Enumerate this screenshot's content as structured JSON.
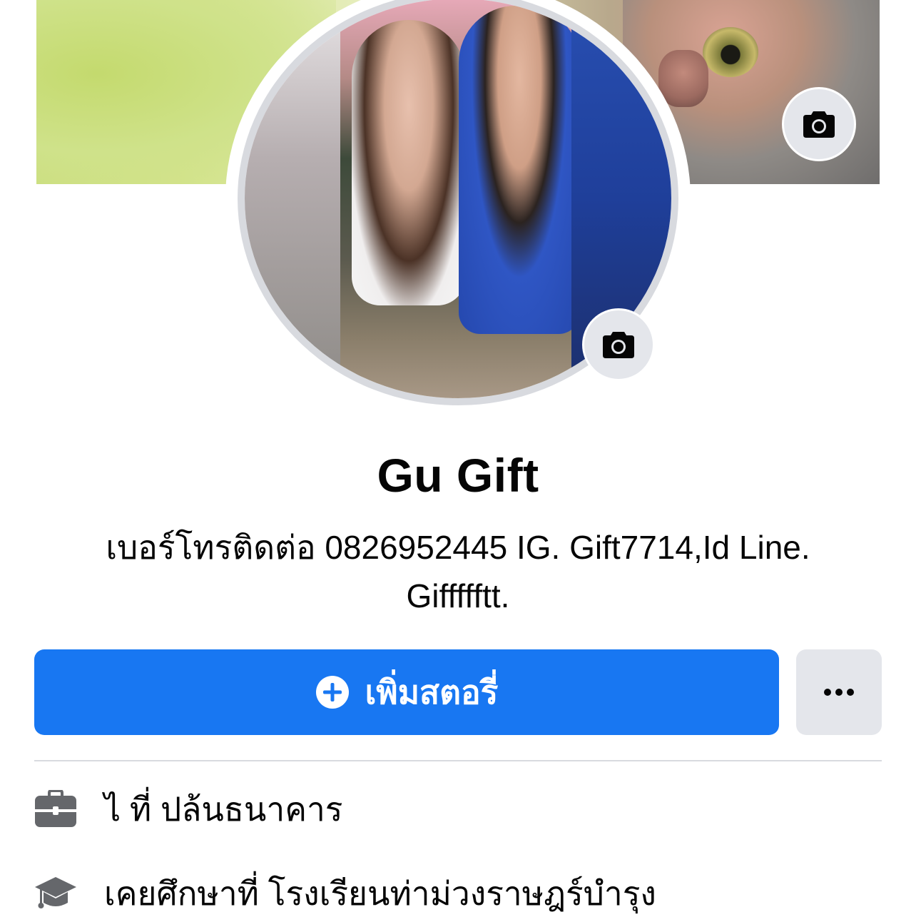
{
  "profile": {
    "name": "Gu Gift",
    "bio": "เบอร์โทรติดต่อ 0826952445 IG. Gift7714,Id Line. Giffffftt."
  },
  "actions": {
    "add_story_label": "เพิ่มสตอรี่",
    "more_label": "•••"
  },
  "intro": {
    "work": "ไ ที่ ปล้นธนาคาร",
    "education": "เคยศึกษาที่ โรงเรียนท่าม่วงราษฎร์บำรุง"
  },
  "colors": {
    "primary": "#1877f2",
    "secondary_bg": "#e4e6eb",
    "icon_gray": "#65676b"
  },
  "icons": {
    "cover_camera": "camera-icon",
    "avatar_camera": "camera-icon",
    "add": "plus-circle-icon",
    "more": "ellipsis-icon",
    "work": "briefcase-icon",
    "education": "graduation-cap-icon"
  }
}
